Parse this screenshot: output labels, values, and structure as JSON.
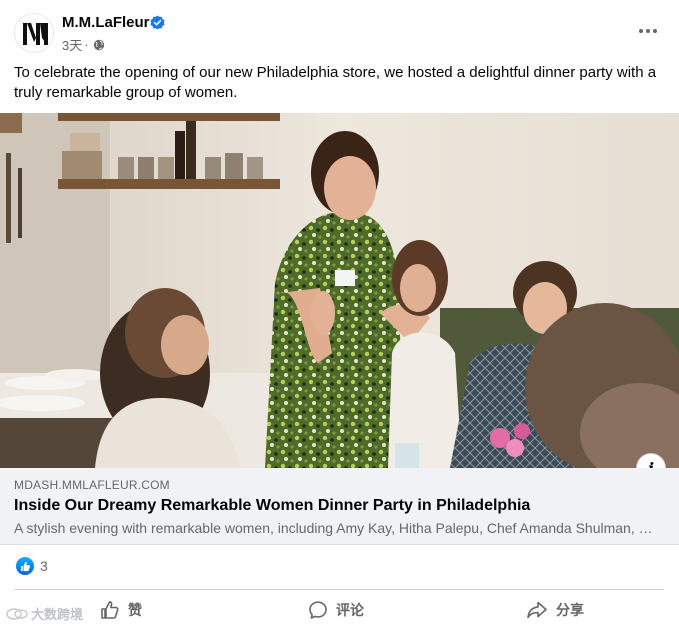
{
  "post": {
    "page_name": "M.M.LaFleur",
    "time": "3天",
    "separator": "·",
    "text": "To celebrate the opening of our new Philadelphia store, we hosted a delightful dinner party with a truly remarkable group of women."
  },
  "link_card": {
    "domain": "MDASH.MMLAFLEUR.COM",
    "title": "Inside Our Dreamy Remarkable Women Dinner Party in Philadelphia",
    "description": "A stylish evening with remarkable women, including Amy Kay, Hitha Palepu, Chef Amanda Shulman, and more."
  },
  "reactions": {
    "count": "3",
    "icon": "like-icon"
  },
  "actions": {
    "like_label": "赞",
    "comment_label": "评论",
    "share_label": "分享"
  },
  "watermark": {
    "text": "大数跨境"
  },
  "colors": {
    "verified": "#1877f2",
    "like_blue": "#0866ff",
    "secondary_text": "#65676b",
    "card_bg": "#f0f2f5"
  }
}
